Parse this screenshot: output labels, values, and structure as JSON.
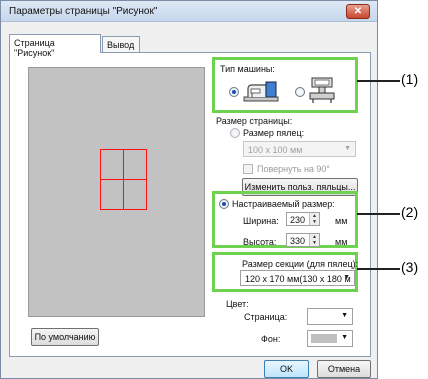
{
  "window": {
    "title": "Параметры страницы \"Рисунок\"",
    "close_symbol": "✕"
  },
  "tabs": [
    {
      "label": "Страница \"Рисунок\"",
      "active": true
    },
    {
      "label": "Вывод",
      "active": false
    }
  ],
  "machine": {
    "label": "Тип машины:",
    "options": [
      "sewing-machine-icon",
      "embroidery-machine-icon"
    ],
    "selected": 0
  },
  "page_size": {
    "label": "Размер страницы:",
    "hoop_size": {
      "label": "Размер пялец:",
      "selected": false,
      "value": "100 x 100 мм"
    },
    "rotate": {
      "label": "Повернуть на 90°",
      "checked": false
    },
    "change_hoops_button": "Изменить польз. пяльцы...",
    "custom": {
      "label": "Настраиваемый размер:",
      "selected": true,
      "width_label": "Ширина:",
      "width_value": "230",
      "width_unit": "мм",
      "height_label": "Высота:",
      "height_value": "330",
      "height_unit": "мм"
    }
  },
  "section": {
    "label": "Размер секции (для пялец):",
    "value": "120 x 170 мм(130 x 180 м"
  },
  "color": {
    "label": "Цвет:",
    "page_label": "Страница:",
    "page_color": "#ffffff",
    "background_label": "Фон:",
    "background_color": "#c0c0c0"
  },
  "buttons": {
    "default": "По умолчанию",
    "ok": "OK",
    "cancel": "Отмена"
  },
  "callouts": [
    "(1)",
    "(2)",
    "(3)"
  ],
  "highlight_color": "#6ed250"
}
